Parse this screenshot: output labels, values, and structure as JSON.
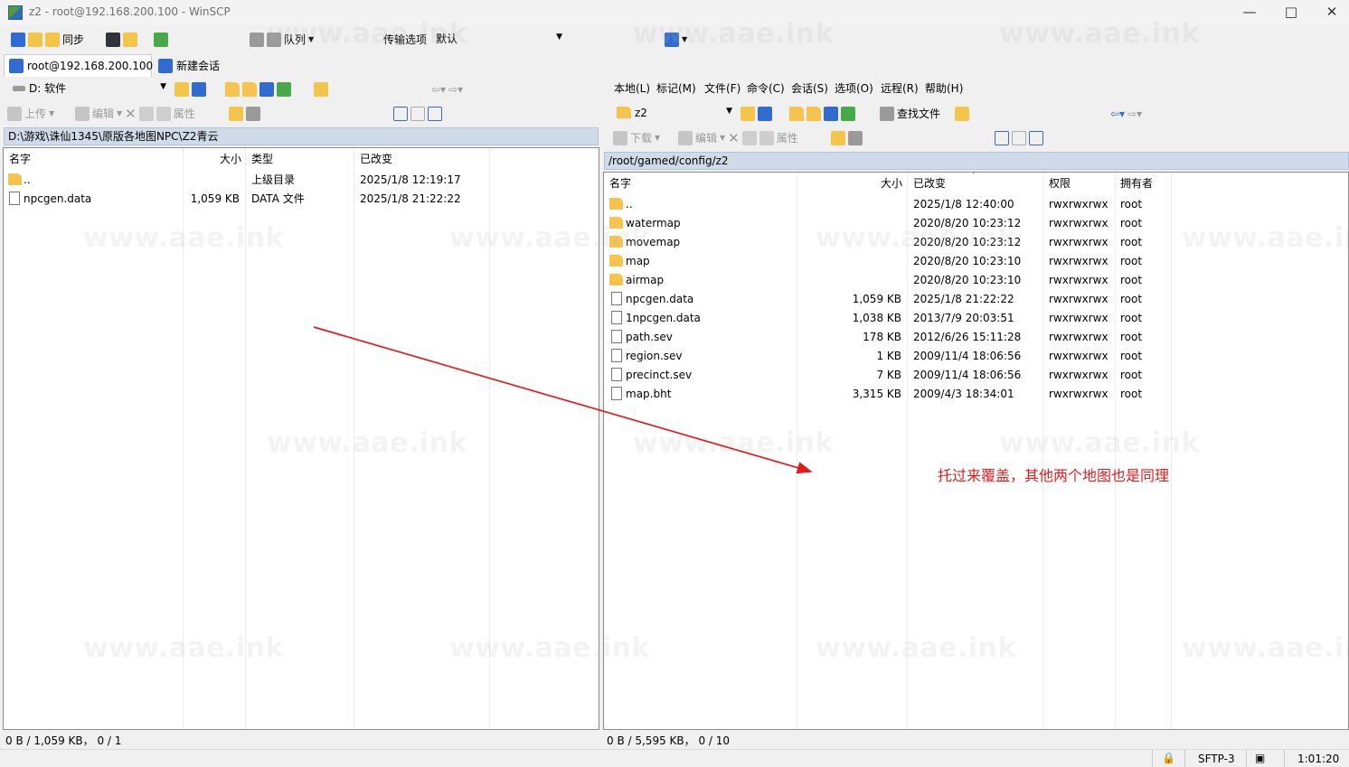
{
  "window": {
    "title": "z2 - root@192.168.200.100 - WinSCP",
    "controls": [
      "—",
      "□",
      "✕"
    ]
  },
  "toolbar": {
    "sync": "同步",
    "queue": "队列",
    "transfer_options_label": "传输选项",
    "transfer_options_value": "默认"
  },
  "tabs": [
    {
      "label": "root@192.168.200.100"
    },
    {
      "label": "新建会话"
    }
  ],
  "left": {
    "drive": "D: 软件",
    "upload": "上传",
    "edit": "编辑",
    "properties": "属性",
    "path": "D:\\游戏\\诛仙1345\\原版各地图NPC\\Z2青云",
    "columns": [
      "名字",
      "大小",
      "类型",
      "已改变"
    ],
    "rows": [
      {
        "name": "..",
        "size": "",
        "type": "上级目录",
        "changed": "2025/1/8  12:19:17"
      },
      {
        "name": "npcgen.data",
        "size": "1,059 KB",
        "type": "DATA 文件",
        "changed": "2025/1/8  21:22:22"
      }
    ],
    "status": "0 B / 1,059 KB，  0 / 1"
  },
  "right": {
    "menu": [
      "本地(L)",
      "标记(M)",
      "文件(F)",
      "命令(C)",
      "会话(S)",
      "选项(O)",
      "远程(R)",
      "帮助(H)"
    ],
    "folder": "z2",
    "find_files": "查找文件",
    "download": "下载",
    "edit": "编辑",
    "properties": "属性",
    "path": "/root/gamed/config/z2",
    "columns": [
      "名字",
      "大小",
      "已改变",
      "权限",
      "拥有者"
    ],
    "rows": [
      {
        "name": "..",
        "size": "",
        "changed": "2025/1/8 12:40:00",
        "rights": "rwxrwxrwx",
        "owner": "root"
      },
      {
        "name": "watermap",
        "size": "",
        "changed": "2020/8/20 10:23:12",
        "rights": "rwxrwxrwx",
        "owner": "root"
      },
      {
        "name": "movemap",
        "size": "",
        "changed": "2020/8/20 10:23:12",
        "rights": "rwxrwxrwx",
        "owner": "root"
      },
      {
        "name": "map",
        "size": "",
        "changed": "2020/8/20 10:23:10",
        "rights": "rwxrwxrwx",
        "owner": "root"
      },
      {
        "name": "airmap",
        "size": "",
        "changed": "2020/8/20 10:23:10",
        "rights": "rwxrwxrwx",
        "owner": "root"
      },
      {
        "name": "npcgen.data",
        "size": "1,059 KB",
        "changed": "2025/1/8 21:22:22",
        "rights": "rwxrwxrwx",
        "owner": "root"
      },
      {
        "name": "1npcgen.data",
        "size": "1,038 KB",
        "changed": "2013/7/9 20:03:51",
        "rights": "rwxrwxrwx",
        "owner": "root"
      },
      {
        "name": "path.sev",
        "size": "178 KB",
        "changed": "2012/6/26 15:11:28",
        "rights": "rwxrwxrwx",
        "owner": "root"
      },
      {
        "name": "region.sev",
        "size": "1 KB",
        "changed": "2009/11/4 18:06:56",
        "rights": "rwxrwxrwx",
        "owner": "root"
      },
      {
        "name": "precinct.sev",
        "size": "7 KB",
        "changed": "2009/11/4 18:06:56",
        "rights": "rwxrwxrwx",
        "owner": "root"
      },
      {
        "name": "map.bht",
        "size": "3,315 KB",
        "changed": "2009/4/3 18:34:01",
        "rights": "rwxrwxrwx",
        "owner": "root"
      }
    ],
    "status": "0 B / 5,595 KB，  0 / 10"
  },
  "statusbar": {
    "protocol": "SFTP-3",
    "time": "1:01:20"
  },
  "annotation": {
    "text": "托过来覆盖，其他两个地图也是同理",
    "color": "#e31b1b"
  },
  "watermark": "www.aae.ink"
}
